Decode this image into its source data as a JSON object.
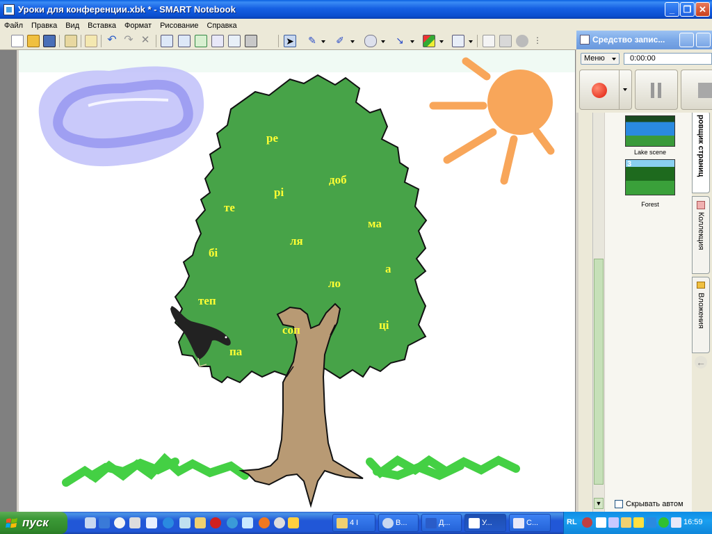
{
  "window": {
    "title": "Уроки для конференции.xbk * - SMART Notebook",
    "minimize": "_",
    "restore": "❐",
    "close": "✕"
  },
  "menu": [
    "Файл",
    "Правка",
    "Вид",
    "Вставка",
    "Формат",
    "Рисование",
    "Справка"
  ],
  "canvas": {
    "words": [
      "ре",
      "рі",
      "доб",
      "те",
      "ма",
      "ля",
      "бі",
      "а",
      "ло",
      "теп",
      "ці",
      "соп",
      "па"
    ]
  },
  "recorder": {
    "title": "Средство запис...",
    "menu_label": "Меню",
    "time": "0:00:00"
  },
  "page_sorter": {
    "tab_label": "ровщик страниц",
    "pages": [
      {
        "label": "Lake scene"
      },
      {
        "number": "3",
        "label": "Forest"
      }
    ],
    "checkbox_label": "Скрывать автом"
  },
  "side_tabs": [
    "Коллекция",
    "Вложения"
  ],
  "taskbar": {
    "start_label": "пуск",
    "tasks": [
      {
        "label": "4 I"
      },
      {
        "label": "В..."
      },
      {
        "label": "Д..."
      },
      {
        "label": "У..."
      },
      {
        "label": "С..."
      }
    ],
    "lang": "RL",
    "clock": "16:59"
  },
  "colors": {
    "tree_green": "#47a348",
    "trunk": "#b89a74",
    "sun": "#f8a65a",
    "cloud": "#b8b8f8",
    "grass": "#44d044",
    "word": "#ffff33"
  }
}
